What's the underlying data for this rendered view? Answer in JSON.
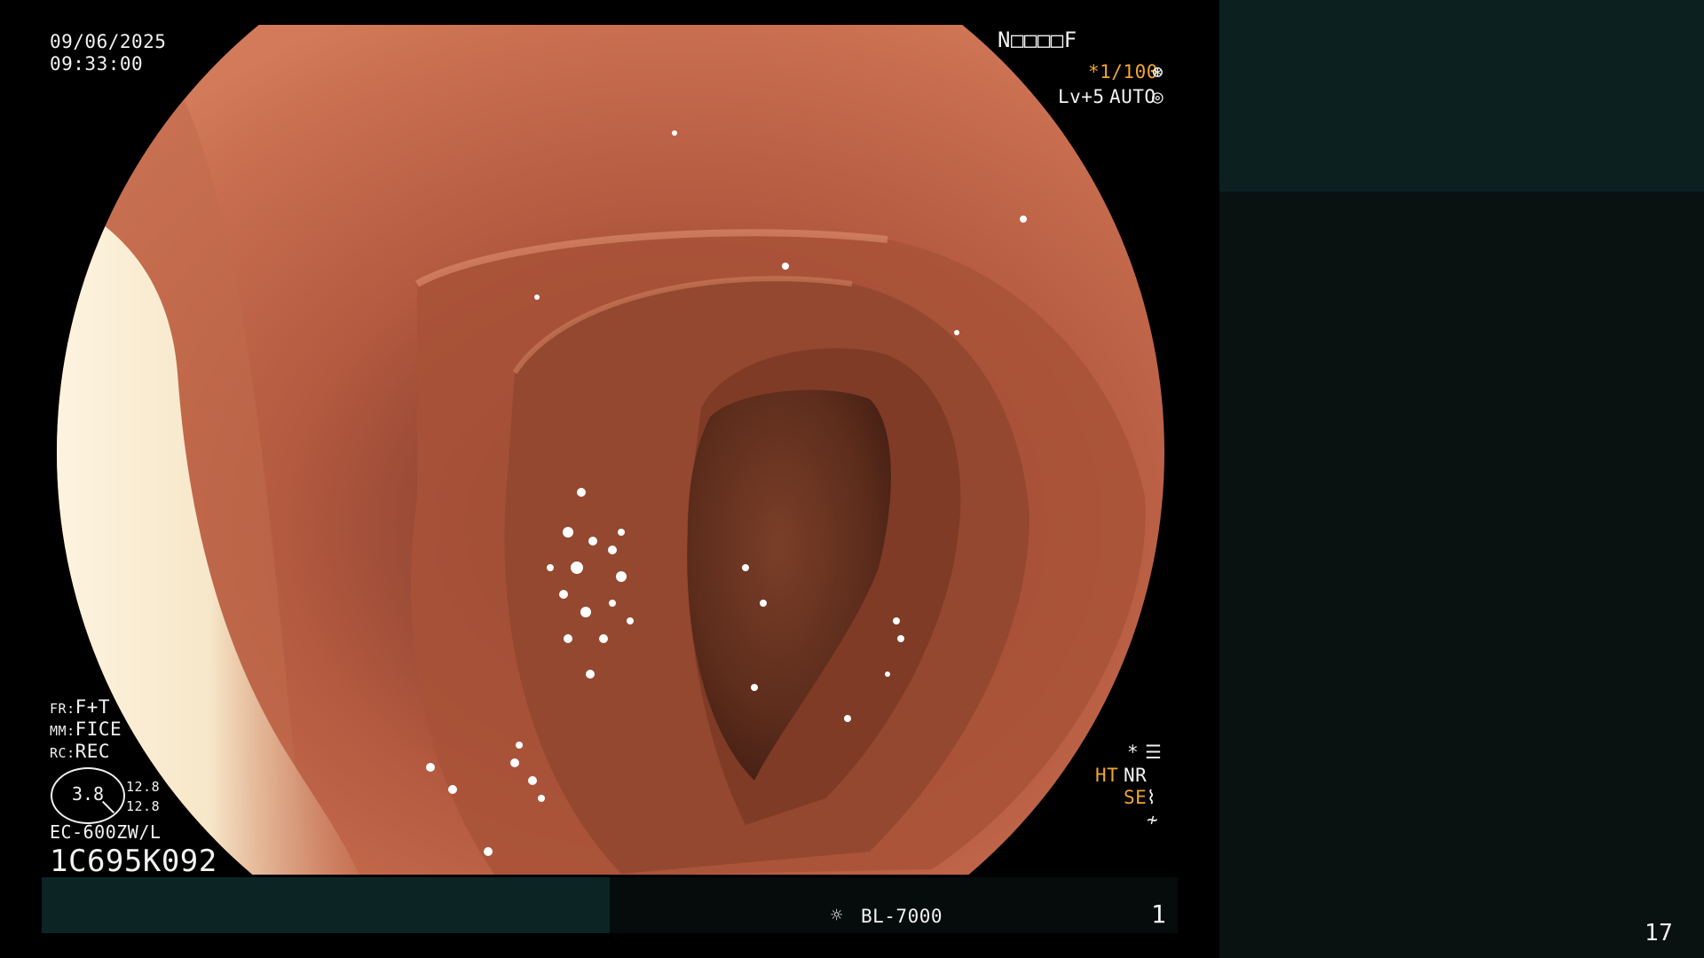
{
  "overlay": {
    "date": "09/06/2025",
    "time": "09:33:00",
    "patient_id": "N□□□□F",
    "shutter": "*1/100",
    "level": "Lv+5",
    "iris": "AUTO",
    "fr_key": "FR",
    "fr_value": "F+T",
    "mm_key": "MM",
    "mm_value": "FICE",
    "rc_key": "RC",
    "rc_value": "REC",
    "gauge_value": "3.8",
    "gauge_right_top": "12.8",
    "gauge_right_bottom": "12.8",
    "scope_model": "EC-600ZW/L",
    "scope_serial": "1C695K092",
    "star": "*",
    "ht": "HT",
    "nr": "NR",
    "se": "SE",
    "processor": "BL-7000",
    "image_number": "1",
    "icons": [
      "aperture-icon",
      "iris-icon",
      "settings-icon",
      "enhance-icon",
      "noise-icon",
      "light-source-icon"
    ]
  },
  "page_number": "17",
  "colors": {
    "amber": "#f0a630",
    "panel_top": "#0c2020",
    "panel_bottom": "#091111"
  }
}
